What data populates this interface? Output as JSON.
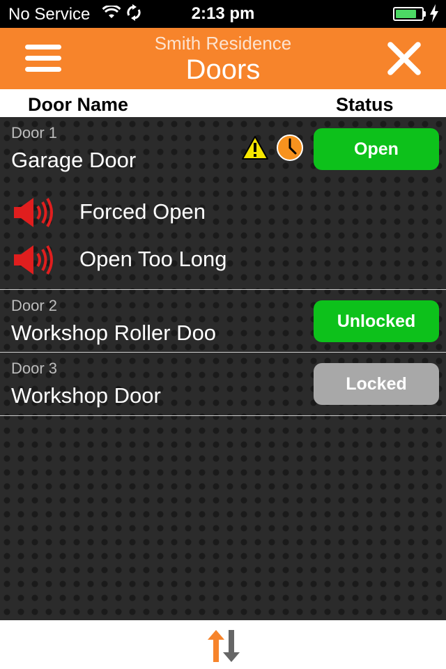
{
  "statusbar": {
    "carrier": "No Service",
    "time": "2:13 pm",
    "battery_level": 0.8,
    "icons": [
      "wifi-icon",
      "sync-status-icon",
      "battery-icon",
      "charging-icon"
    ]
  },
  "header": {
    "subtitle": "Smith Residence",
    "title": "Doors",
    "background_color": "#f7842b"
  },
  "columns": {
    "name": "Door Name",
    "status": "Status"
  },
  "doors": [
    {
      "number": "Door 1",
      "name": "Garage Door",
      "status": "Open",
      "status_color": "#0dc11b",
      "icons": [
        "warning-icon",
        "clock-icon"
      ],
      "alarms": [
        "Forced Open",
        "Open Too Long"
      ]
    },
    {
      "number": "Door 2",
      "name": "Workshop Roller Doo",
      "status": "Unlocked",
      "status_color": "#0dc11b"
    },
    {
      "number": "Door 3",
      "name": "Workshop Door",
      "status": "Locked",
      "status_color": "#a8a8a8"
    }
  ],
  "bottombar": {
    "icon": "sync-arrows-icon"
  }
}
